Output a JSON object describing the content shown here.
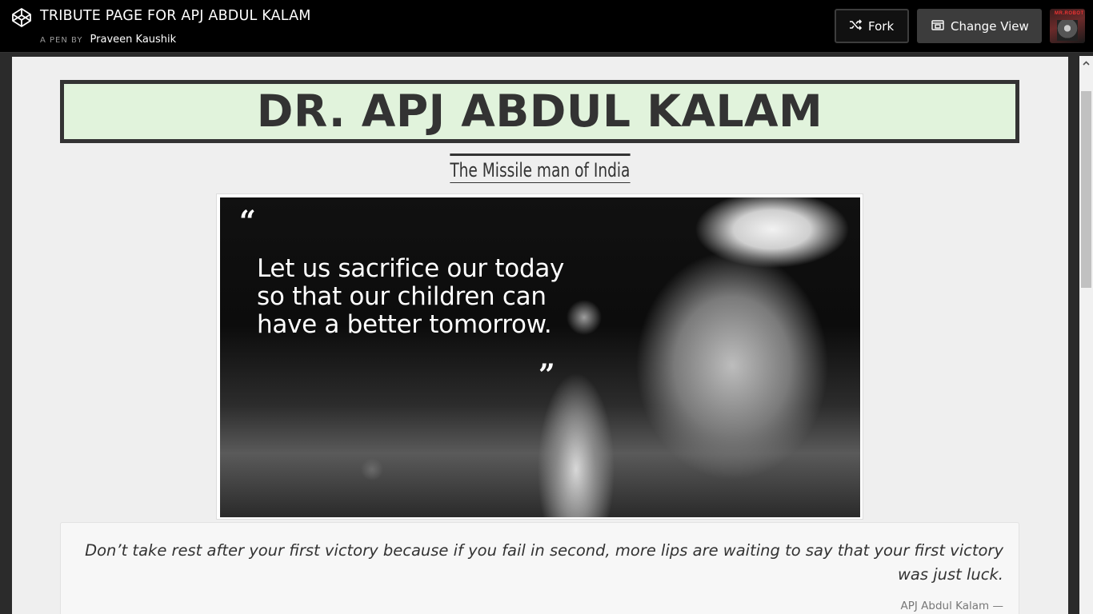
{
  "header": {
    "pen_title": "TRIBUTE PAGE FOR APJ ABDUL KALAM",
    "byline_prefix": "A PEN BY",
    "author": "Praveen Kaushik",
    "fork_label": "Fork",
    "change_view_label": "Change View",
    "avatar_text": "MR.ROBOT"
  },
  "tribute": {
    "title": "DR. APJ ABDUL KALAM",
    "subtitle": "The Missile man of India",
    "image_quote": "Let us sacrifice our today so that our children can have a better tomorrow.",
    "image_quote_open": "“",
    "image_quote_close": "”",
    "quote": "Don’t take rest after your first victory because if you fail in second, more lips are waiting to say that your first victory was just luck.",
    "quote_author": "APJ Abdul Kalam —"
  },
  "colors": {
    "topbar": "#000000",
    "title_bg": "#e1f3dc",
    "title_border": "#333333",
    "page_bg": "#efefef"
  },
  "icons": {
    "logo": "codepen-logo-icon",
    "fork": "fork-icon",
    "change_view": "change-view-icon",
    "scroll_up": "scroll-up-arrow-icon"
  }
}
